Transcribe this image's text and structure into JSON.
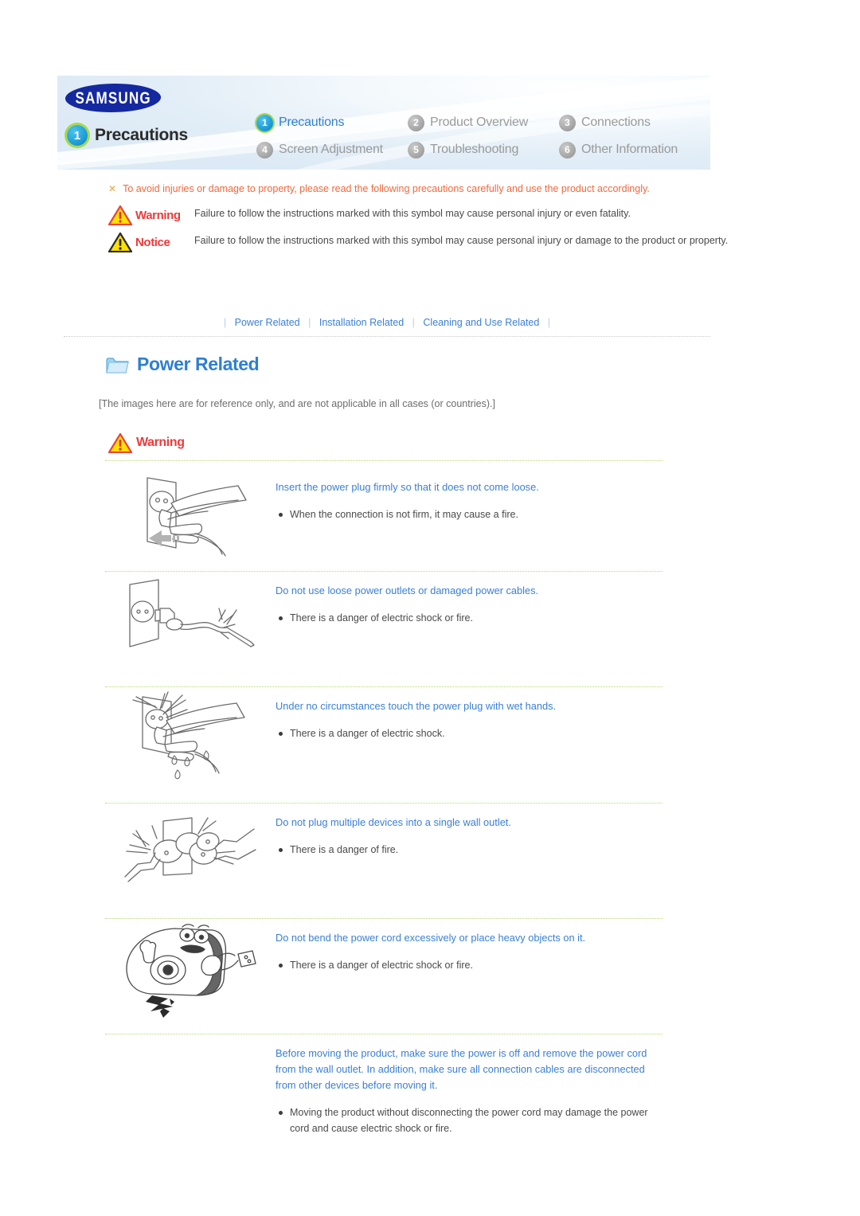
{
  "header": {
    "brand": "SAMSUNG",
    "section_number": "1",
    "section_title": "Precautions",
    "nav_items": [
      {
        "number": "1",
        "label": "Precautions",
        "active": true
      },
      {
        "number": "2",
        "label": "Product Overview",
        "active": false
      },
      {
        "number": "3",
        "label": "Connections",
        "active": false
      },
      {
        "number": "4",
        "label": "Screen Adjustment",
        "active": false
      },
      {
        "number": "5",
        "label": "Troubleshooting",
        "active": false
      },
      {
        "number": "6",
        "label": "Other Information",
        "active": false
      }
    ]
  },
  "intro": {
    "x_mark": "✕",
    "note": "To avoid injuries or damage to property, please read the following precautions carefully and use the product accordingly.",
    "warning_label": "Warning",
    "warning_text": "Failure to follow the instructions marked with this symbol may cause personal injury or even fatality.",
    "notice_label": "Notice",
    "notice_text": "Failure to follow the instructions marked with this symbol may cause personal injury or damage to the product or property."
  },
  "subnav": {
    "separator": "|",
    "links": [
      "Power Related",
      "Installation Related",
      "Cleaning and Use Related"
    ]
  },
  "section": {
    "title": "Power Related",
    "reference_note": "[The images here are for reference only, and are not applicable in all cases (or countries).]",
    "warning_label": "Warning"
  },
  "colors": {
    "link_blue": "#3a7fd5",
    "heading_blue": "#2f7fd0",
    "warning_red": "#ef3a3a",
    "note_orange": "#f0683c",
    "rule_green": "#b9d96a",
    "samsung_blue": "#1428a0",
    "active_badge": "#1b9ad6",
    "active_badge_ring": "#a8d94a"
  },
  "precautions": [
    {
      "figure": "power-plug-insert-illustration",
      "heading": "Insert the power plug firmly so that it does not come loose.",
      "bullets": [
        "When the connection is not firm, it may cause a fire."
      ]
    },
    {
      "figure": "damaged-power-cable-illustration",
      "heading": "Do not use loose power outlets or damaged power cables.",
      "bullets": [
        "There is a danger of electric shock or fire."
      ]
    },
    {
      "figure": "wet-hands-plug-illustration",
      "heading": "Under no circumstances touch the power plug with wet hands.",
      "bullets": [
        "There is a danger of electric shock."
      ]
    },
    {
      "figure": "multiple-devices-outlet-illustration",
      "heading": "Do not plug multiple devices into a single wall outlet.",
      "bullets": [
        "There is a danger of fire."
      ]
    },
    {
      "figure": "bent-power-cord-projector-illustration",
      "heading": "Do not bend the power cord excessively or place heavy objects on it.",
      "bullets": [
        "There is a danger of electric shock or fire."
      ]
    },
    {
      "figure": "",
      "heading": "Before moving the product, make sure the power is off and remove the power cord from the wall outlet. In addition, make sure all connection cables are disconnected from other devices before moving it.",
      "bullets": [
        "Moving the product without disconnecting the power cord may damage the power cord and cause electric shock or fire."
      ]
    }
  ]
}
